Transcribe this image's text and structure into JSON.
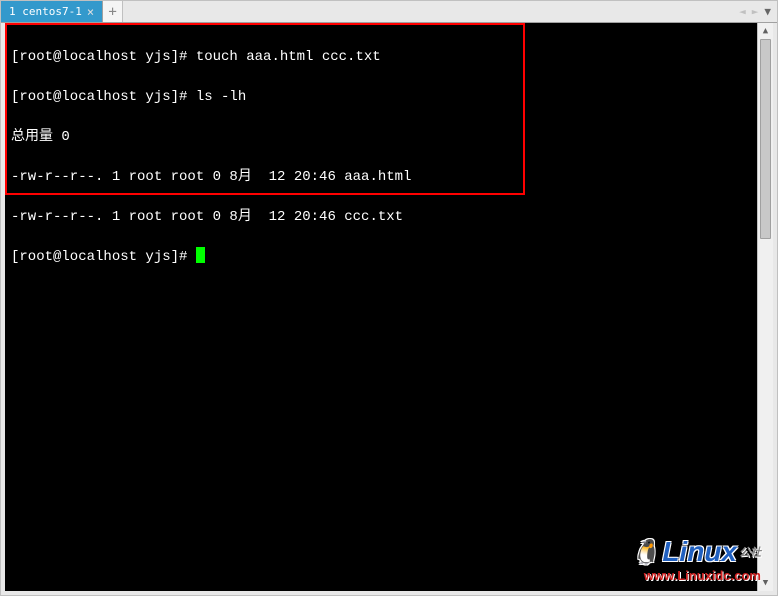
{
  "tab": {
    "label": "1 centos7-1",
    "close": "×"
  },
  "tab_add": "+",
  "nav": {
    "left": "◄",
    "right": "►",
    "dropdown": "▼"
  },
  "terminal": {
    "lines": [
      "[root@localhost yjs]# touch aaa.html ccc.txt",
      "[root@localhost yjs]# ls -lh",
      "总用量 0",
      "-rw-r--r--. 1 root root 0 8月  12 20:46 aaa.html",
      "-rw-r--r--. 1 root root 0 8月  12 20:46 ccc.txt"
    ],
    "prompt": "[root@localhost yjs]# "
  },
  "scrollbar": {
    "up": "▲",
    "down": "▼"
  },
  "watermark": {
    "brand": "Linux",
    "sub": "公社",
    "url": "www.Linuxidc.com"
  }
}
